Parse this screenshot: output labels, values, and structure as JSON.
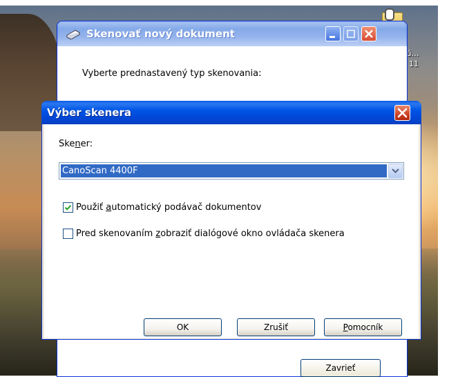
{
  "desktop": {
    "icon_name": "folder-with-clip-icon",
    "label_line1": "j,ú…",
    "label_line2": "11"
  },
  "back_window": {
    "title": "Skenovať nový dokument",
    "prompt": "Vyberte prednastavený typ skenovania:",
    "close_button": "Zavrieť"
  },
  "dialog": {
    "title": "Výber skenera",
    "scanner_label_pre": "Ske",
    "scanner_label_underlined": "n",
    "scanner_label_post": "er:",
    "scanner_selected": "CanoScan 4400F",
    "checkbox_adf": {
      "checked": true,
      "label_pre": "Použiť ",
      "label_underlined": "a",
      "label_post": "utomatický podávač dokumentov"
    },
    "checkbox_driver": {
      "checked": false,
      "label_pre": "Pred skenovaním ",
      "label_underlined": "z",
      "label_post": "obraziť dialógové okno ovládača skenera"
    },
    "buttons": {
      "ok": "OK",
      "cancel": "Zrušiť",
      "help_underlined": "P",
      "help_rest": "omocník"
    }
  },
  "colors": {
    "title_blue": "#0055e5",
    "selection_blue": "#316ac5",
    "close_red": "#d8442b"
  }
}
